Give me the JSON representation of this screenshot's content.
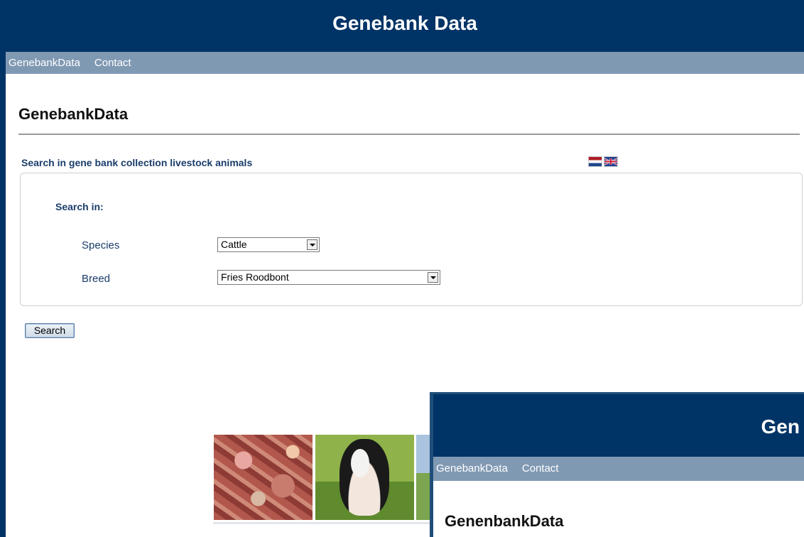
{
  "main_window": {
    "header": {
      "title": "Genebank Data"
    },
    "nav": [
      {
        "label": "GenebankData"
      },
      {
        "label": "Contact"
      }
    ],
    "page_title": "GenebankData",
    "search_heading": "Search in gene bank collection livestock animals",
    "languages": [
      "dutch-flag-icon",
      "uk-flag-icon"
    ],
    "form": {
      "section_label": "Search in:",
      "species": {
        "label": "Species",
        "value": "Cattle"
      },
      "breed": {
        "label": "Breed",
        "value": "Fries Roodbont"
      }
    },
    "search_button": "Search",
    "images": [
      "cells-photo",
      "cow-photo",
      "landscape-photo"
    ]
  },
  "second_window": {
    "header": {
      "title": "Gen"
    },
    "nav": [
      {
        "label": "GenebankData"
      },
      {
        "label": "Contact"
      }
    ],
    "page_title": "GenenbankData"
  },
  "colors": {
    "header_bg": "#003366",
    "nav_bg": "#8099b3",
    "label_color": "#1a3d6b"
  }
}
